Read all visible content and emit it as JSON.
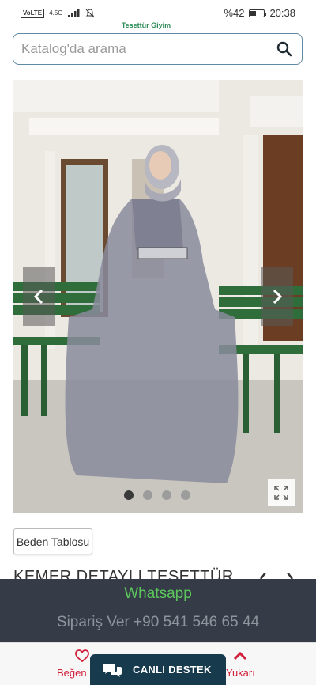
{
  "status_bar": {
    "network_badge": "VoLTE",
    "network_type": "4.5G",
    "battery_text": "%42",
    "battery_level": 0.42,
    "time": "20:38"
  },
  "brand": {
    "strip_text": "Tesettür Giyim"
  },
  "search": {
    "placeholder": "Katalog'da arama",
    "value": ""
  },
  "gallery": {
    "image_alt": "Product photo",
    "dots_count": 4,
    "active_dot": 0,
    "icons": {
      "prev": "chevron-left-icon",
      "next": "chevron-right-icon",
      "expand": "expand-icon"
    }
  },
  "product": {
    "size_table_label": "Beden Tablosu",
    "title": "KEMER DETAYLI TESETTÜR"
  },
  "whatsapp": {
    "title": "Whatsapp",
    "order_line": "Sipariş Ver +90 541 546 65 44"
  },
  "bottom_bar": {
    "like_label": "Beğen",
    "live_support_label": "CANLI DESTEK",
    "up_label": "Yukarı",
    "accent": "#d0203a"
  }
}
